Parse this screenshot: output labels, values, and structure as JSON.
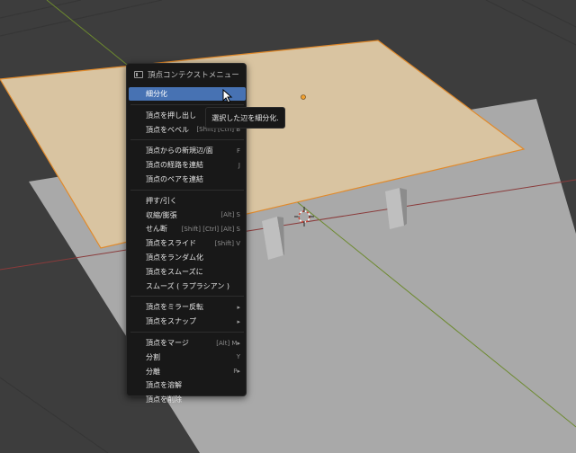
{
  "menu": {
    "title": "頂点コンテクストメニュー",
    "groups": [
      [
        {
          "label": "細分化",
          "shortcut": "",
          "active": true
        }
      ],
      [
        {
          "label": "頂点を押し出し",
          "shortcut": ""
        },
        {
          "label": "頂点をベベル",
          "shortcut": "[Shift] [Ctrl] B"
        }
      ],
      [
        {
          "label": "頂点からの新規辺/面",
          "shortcut": "F"
        },
        {
          "label": "頂点の経路を連結",
          "shortcut": "J"
        },
        {
          "label": "頂点のペアを連結",
          "shortcut": ""
        }
      ],
      [
        {
          "label": "押す/引く",
          "shortcut": ""
        },
        {
          "label": "収縮/膨張",
          "shortcut": "[Alt] S"
        },
        {
          "label": "せん断",
          "shortcut": "[Shift] [Ctrl] [Alt] S"
        },
        {
          "label": "頂点をスライド",
          "shortcut": "[Shift] V"
        },
        {
          "label": "頂点をランダム化",
          "shortcut": ""
        },
        {
          "label": "頂点をスムーズに",
          "shortcut": ""
        },
        {
          "label": "スムーズ ( ラプラシアン )",
          "shortcut": ""
        }
      ],
      [
        {
          "label": "頂点をミラー反転",
          "shortcut": "",
          "submenu": true
        },
        {
          "label": "頂点をスナップ",
          "shortcut": "",
          "submenu": true
        }
      ],
      [
        {
          "label": "頂点をマージ",
          "shortcut": "[Alt] M",
          "submenu": true
        },
        {
          "label": "分割",
          "shortcut": "Y"
        },
        {
          "label": "分離",
          "shortcut": "P",
          "submenu": true
        },
        {
          "label": "頂点を溶解",
          "shortcut": ""
        },
        {
          "label": "頂点を削除",
          "shortcut": ""
        }
      ]
    ]
  },
  "tooltip": {
    "text": "選択した辺を細分化."
  },
  "icons": {
    "menu_title": "menu-context-icon",
    "submenu": "submenu-arrow-icon",
    "cursor": "mouse-pointer-icon",
    "origin": "3d-cursor-icon"
  },
  "colors": {
    "highlight": "#4772b3",
    "plane": "#d9c4a1",
    "floor": "#a9a9a9",
    "background": "#3d3d3d"
  }
}
